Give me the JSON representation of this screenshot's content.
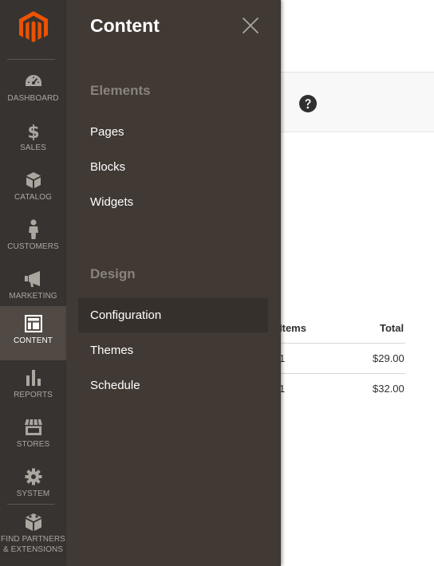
{
  "sidebar": {
    "items": [
      {
        "label": "DASHBOARD",
        "icon": "dashboard-icon"
      },
      {
        "label": "SALES",
        "icon": "dollar-icon"
      },
      {
        "label": "CATALOG",
        "icon": "catalog-box-icon"
      },
      {
        "label": "CUSTOMERS",
        "icon": "customer-person-icon"
      },
      {
        "label": "MARKETING",
        "icon": "megaphone-icon"
      },
      {
        "label": "CONTENT",
        "icon": "content-layout-icon",
        "active": true
      },
      {
        "label": "REPORTS",
        "icon": "bar-chart-icon"
      },
      {
        "label": "STORES",
        "icon": "store-icon"
      },
      {
        "label": "SYSTEM",
        "icon": "gear-icon"
      },
      {
        "label": "FIND PARTNERS\n& EXTENSIONS",
        "label_line1": "FIND PARTNERS",
        "label_line2": "& EXTENSIONS",
        "icon": "extensions-blocks-icon"
      }
    ]
  },
  "flyout": {
    "title": "Content",
    "close_icon": "close-icon",
    "sections": [
      {
        "title": "Elements",
        "items": [
          "Pages",
          "Blocks",
          "Widgets"
        ]
      },
      {
        "title": "Design",
        "items": [
          "Configuration",
          "Themes",
          "Schedule"
        ]
      }
    ],
    "active_item": "Configuration"
  },
  "background_page": {
    "help_icon": "help-question-icon",
    "table": {
      "headers": {
        "items": "Items",
        "total": "Total"
      },
      "rows": [
        {
          "items": "1",
          "total": "$29.00"
        },
        {
          "items": "1",
          "total": "$32.00"
        }
      ]
    }
  },
  "colors": {
    "sidebar_bg": "#373330",
    "sidebar_active_bg": "#514943",
    "flyout_bg": "#403934",
    "brand_orange": "#eb5202"
  }
}
